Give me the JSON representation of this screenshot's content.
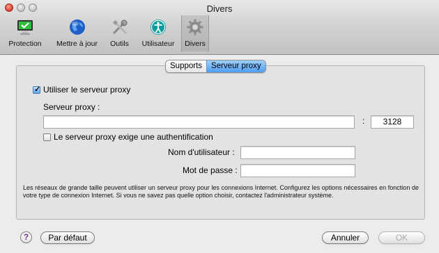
{
  "window": {
    "title": "Divers"
  },
  "toolbar": {
    "items": [
      {
        "label": "Protection",
        "icon": "monitor-check-icon"
      },
      {
        "label": "Mettre à jour",
        "icon": "globe-icon"
      },
      {
        "label": "Outils",
        "icon": "tools-icon"
      },
      {
        "label": "Utilisateur",
        "icon": "user-icon"
      },
      {
        "label": "Divers",
        "icon": "gear-icon",
        "selected": true
      }
    ]
  },
  "tabs": [
    {
      "label": "Supports",
      "active": false
    },
    {
      "label": "Serveur proxy",
      "active": true
    }
  ],
  "proxy": {
    "use_proxy_label": "Utiliser le serveur proxy",
    "use_proxy_checked": true,
    "server_label": "Serveur proxy :",
    "server_value": "",
    "port_separator": ":",
    "port_value": "3128",
    "auth_label": "Le serveur proxy exige une authentification",
    "auth_checked": false,
    "username_label": "Nom d'utilisateur :",
    "username_value": "",
    "password_label": "Mot de passe :",
    "password_value": ""
  },
  "info_text": "Les réseaux de grande taille peuvent utiliser un serveur proxy pour les connexions Internet. Configurez les options nécessaires en fonction de votre type de connexion Internet. Si vous ne savez pas quelle option choisir, contactez l'administrateur système.",
  "footer": {
    "help_label": "?",
    "default_button": "Par défaut",
    "cancel_button": "Annuler",
    "ok_button": "OK"
  }
}
